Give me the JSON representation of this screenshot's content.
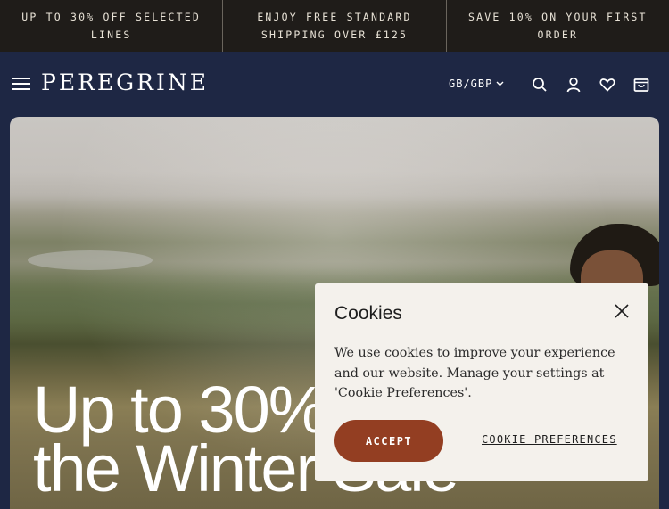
{
  "promo": [
    {
      "text": "UP TO 30% OFF SELECTED LINES"
    },
    {
      "text": "ENJOY FREE STANDARD SHIPPING OVER £125"
    },
    {
      "text": "SAVE 10% ON YOUR FIRST ORDER"
    }
  ],
  "header": {
    "logo": "PEREGRINE",
    "currency": "GB/GBP",
    "icons": [
      "menu-icon",
      "search-icon",
      "account-icon",
      "wishlist-icon",
      "bag-icon"
    ]
  },
  "hero": {
    "heading_line1": "Up to 30%",
    "heading_line2": "the Winter Sale"
  },
  "cookie": {
    "title": "Cookies",
    "body": "We use cookies to improve your experience and our website. Manage your settings at 'Cookie Preferences'.",
    "accept_label": "ACCEPT",
    "preferences_label": "COOKIE PREFERENCES"
  },
  "colors": {
    "header_bg": "#1e2744",
    "promo_bg": "#1f1c19",
    "accept_bg": "#933e22",
    "cookie_bg": "#f4f1ec"
  }
}
